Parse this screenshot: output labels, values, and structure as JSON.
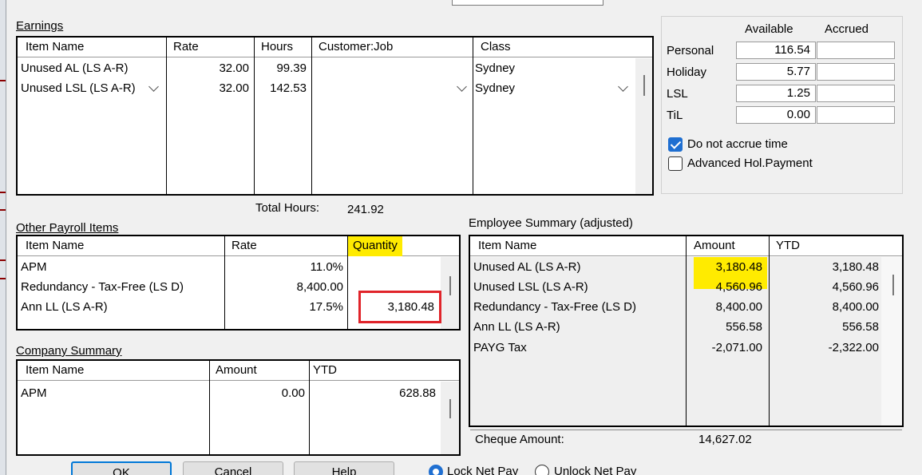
{
  "earnings": {
    "title": "Earnings",
    "columns": [
      "Item Name",
      "Rate",
      "Hours",
      "Customer:Job",
      "Class"
    ],
    "rows": [
      {
        "item": "Unused AL (LS A-R)",
        "rate": "32.00",
        "hours": "99.39",
        "job": "",
        "class": "Sydney"
      },
      {
        "item": "Unused LSL (LS A-R)",
        "rate": "32.00",
        "hours": "142.53",
        "job": "",
        "class": "Sydney"
      }
    ],
    "total_label": "Total Hours:",
    "total_value": "241.92"
  },
  "accruals": {
    "col_available": "Available",
    "col_accrued": "Accrued",
    "rows": [
      {
        "label": "Personal",
        "available": "116.54",
        "accrued": ""
      },
      {
        "label": "Holiday",
        "available": "5.77",
        "accrued": ""
      },
      {
        "label": "LSL",
        "available": "1.25",
        "accrued": ""
      },
      {
        "label": "TiL",
        "available": "0.00",
        "accrued": ""
      }
    ],
    "no_accrue_label": "Do not accrue time",
    "no_accrue_checked": true,
    "adv_hol_label": "Advanced Hol.Payment",
    "adv_hol_checked": false
  },
  "other_payroll": {
    "title": "Other Payroll Items",
    "columns": [
      "Item Name",
      "Rate",
      "Quantity"
    ],
    "rows": [
      {
        "item": "APM",
        "rate": "11.0%",
        "qty": ""
      },
      {
        "item": "Redundancy - Tax-Free (LS D)",
        "rate": "8,400.00",
        "qty": ""
      },
      {
        "item": "Ann LL (LS A-R)",
        "rate": "17.5%",
        "qty": "3,180.48"
      }
    ]
  },
  "company_summary": {
    "title": "Company Summary",
    "columns": [
      "Item Name",
      "Amount",
      "YTD"
    ],
    "rows": [
      {
        "item": "APM",
        "amount": "0.00",
        "ytd": "628.88"
      }
    ]
  },
  "employee_summary": {
    "title": "Employee Summary (adjusted)",
    "columns": [
      "Item Name",
      "Amount",
      "YTD"
    ],
    "rows": [
      {
        "item": "Unused AL (LS A-R)",
        "amount": "3,180.48",
        "ytd": "3,180.48"
      },
      {
        "item": "Unused LSL (LS A-R)",
        "amount": "4,560.96",
        "ytd": "4,560.96"
      },
      {
        "item": "Redundancy - Tax-Free (LS D)",
        "amount": "8,400.00",
        "ytd": "8,400.00"
      },
      {
        "item": "Ann LL (LS A-R)",
        "amount": "556.58",
        "ytd": "556.58"
      },
      {
        "item": "PAYG Tax",
        "amount": "-2,071.00",
        "ytd": "-2,322.00"
      }
    ],
    "cheque_label": "Cheque Amount:",
    "cheque_value": "14,627.02"
  },
  "buttons": {
    "ok": "OK",
    "cancel": "Cancel",
    "help": "Help"
  },
  "net_pay": {
    "lock": "Lock Net Pay",
    "unlock": "Unlock Net Pay",
    "selected": "lock"
  },
  "colors": {
    "highlight": "#ffeb00",
    "annotation_red": "#e0242a",
    "checkbox_blue": "#1f6fd1"
  }
}
